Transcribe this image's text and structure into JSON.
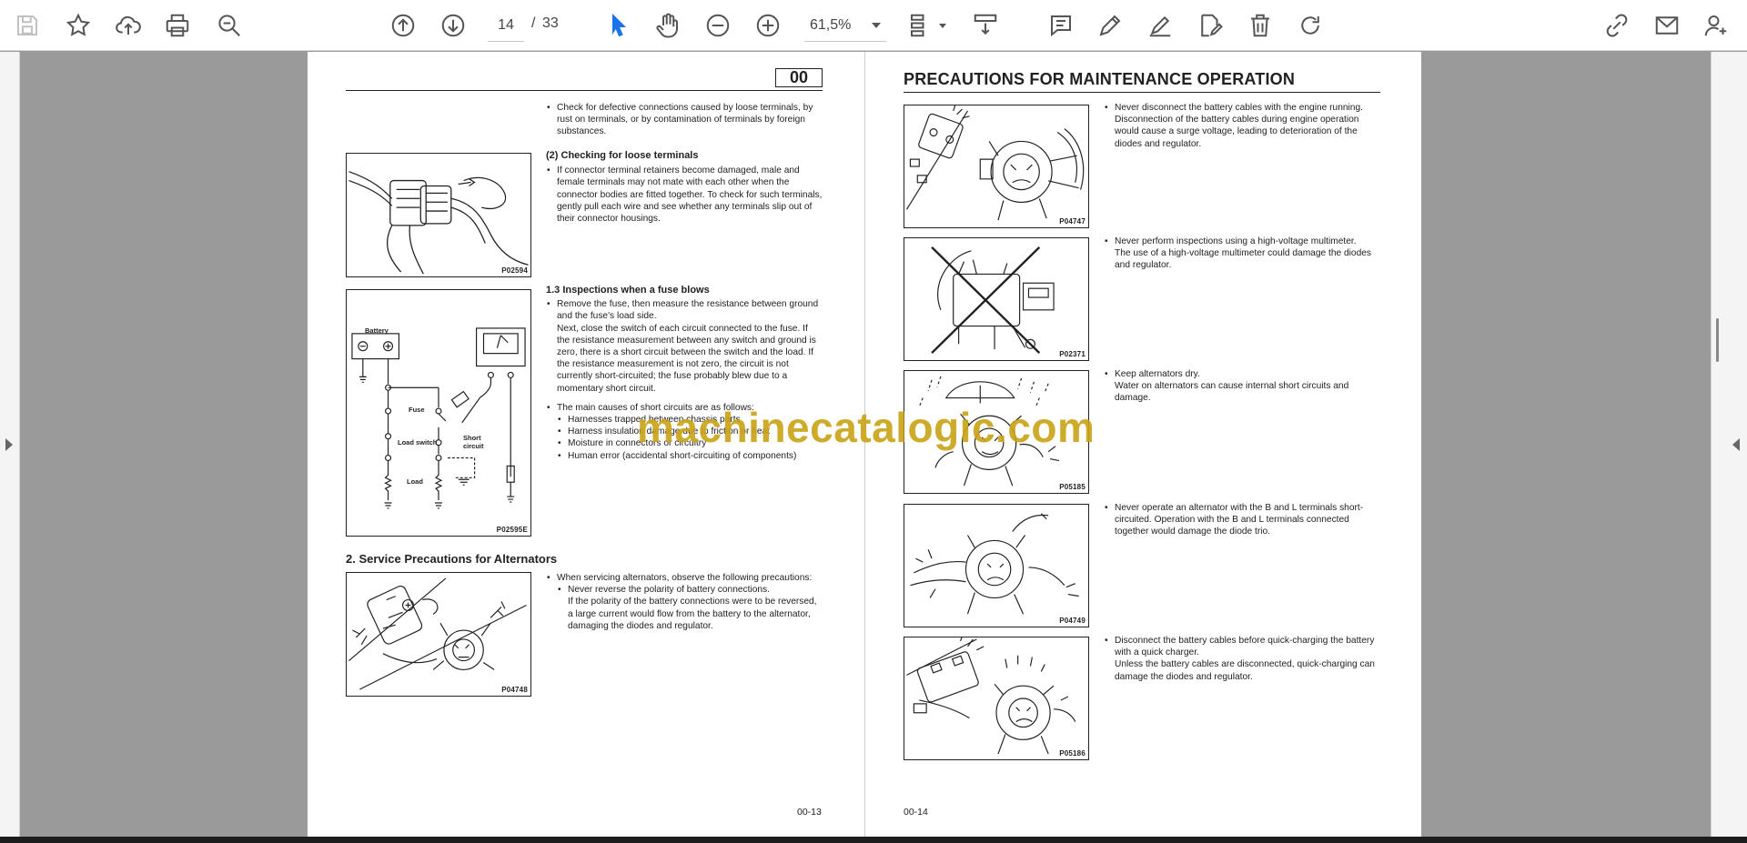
{
  "toolbar": {
    "icons": [
      "save-icon",
      "star-icon",
      "upload-icon",
      "print-icon",
      "zoom-search-icon",
      "arrow-up-icon",
      "arrow-down-icon",
      "select-cursor-icon",
      "hand-icon",
      "zoom-out-icon",
      "zoom-in-icon",
      "page-layout-icon",
      "scroll-mode-icon",
      "comment-icon",
      "pen-icon",
      "sign-icon",
      "edit-pdf-icon",
      "delete-icon",
      "redo-icon",
      "share-link-icon",
      "mail-icon",
      "add-user-icon"
    ],
    "current_page": "14",
    "page_separator": "/",
    "total_pages": "33",
    "zoom": "61,5%",
    "accent_color": "#1a73e8"
  },
  "watermark": "machinecatalogic.com",
  "left_page": {
    "section": "00",
    "intro_bullet": "Check for defective connections caused by loose terminals, by rust on terminals, or by contamination of terminals by foreign substances.",
    "sub2_heading": "(2)  Checking for loose terminals",
    "sub2_bullet": "If connector terminal retainers become damaged, male and female terminals may not mate with each other when the connector bodies are fitted together. To check for such terminals, gently pull each wire and see whether any terminals slip out of their connector housings.",
    "fig1_code": "P02594",
    "s13_heading": "1.3  Inspections when a fuse blows",
    "s13_b1_l1": "Remove the fuse, then measure the resistance between ground and the fuse's load side.",
    "s13_b1_l2": "Next, close the switch of each circuit connected to the fuse. If the resistance measurement between any switch and ground is zero, there is a short circuit between the switch and the load. If the resistance measurement is not zero, the circuit is not currently short-circuited; the fuse probably blew due to a momentary short circuit.",
    "s13_b2": "The main causes of short circuits are as follows:",
    "s13_causes": [
      "Harnesses trapped between chassis parts",
      "Harness insulation damage due to friction or heat",
      "Moisture in connectors or circuitry",
      "Human error (accidental short-circuiting of components)"
    ],
    "fig2_labels": {
      "battery": "Battery",
      "fuse": "Fuse",
      "load_switch": "Load switch",
      "load": "Load",
      "short": "Short",
      "circuit": "circuit",
      "code": "P02595E"
    },
    "s2_heading": "2.  Service Precautions for Alternators",
    "s2_b1": "When servicing alternators, observe the following precautions:",
    "s2_sub": "Never reverse the polarity of battery connections.",
    "s2_text": "If the polarity of the battery connections were to be reversed, a large current would flow from the battery to the alternator, damaging the diodes and regulator.",
    "fig3_code": "P04748",
    "page_number": "00-13"
  },
  "right_page": {
    "title": "PRECAUTIONS FOR MAINTENANCE OPERATION",
    "items": [
      {
        "bullet": "Never disconnect the battery cables with the engine running.",
        "text": "Disconnection of the battery cables during engine operation would cause a surge voltage, leading to deterioration of the diodes and regulator.",
        "code": "P04747"
      },
      {
        "bullet": "Never perform inspections using a high-voltage multimeter.",
        "text": "The use of a high-voltage multimeter could damage the diodes and regulator.",
        "code": "P02371"
      },
      {
        "bullet": "Keep alternators dry.",
        "text": "Water on alternators can cause internal short circuits and damage.",
        "code": "P05185"
      },
      {
        "bullet": "Never operate an alternator with the B and L terminals short-circuited. Operation with the B and L terminals connected together would damage the diode trio.",
        "text": "",
        "code": "P04749"
      },
      {
        "bullet": "Disconnect the battery cables before quick-charging the battery with a quick charger.",
        "text": "Unless the battery cables are disconnected, quick-charging can damage the diodes and regulator.",
        "code": "P05186"
      }
    ],
    "page_number": "00-14"
  }
}
